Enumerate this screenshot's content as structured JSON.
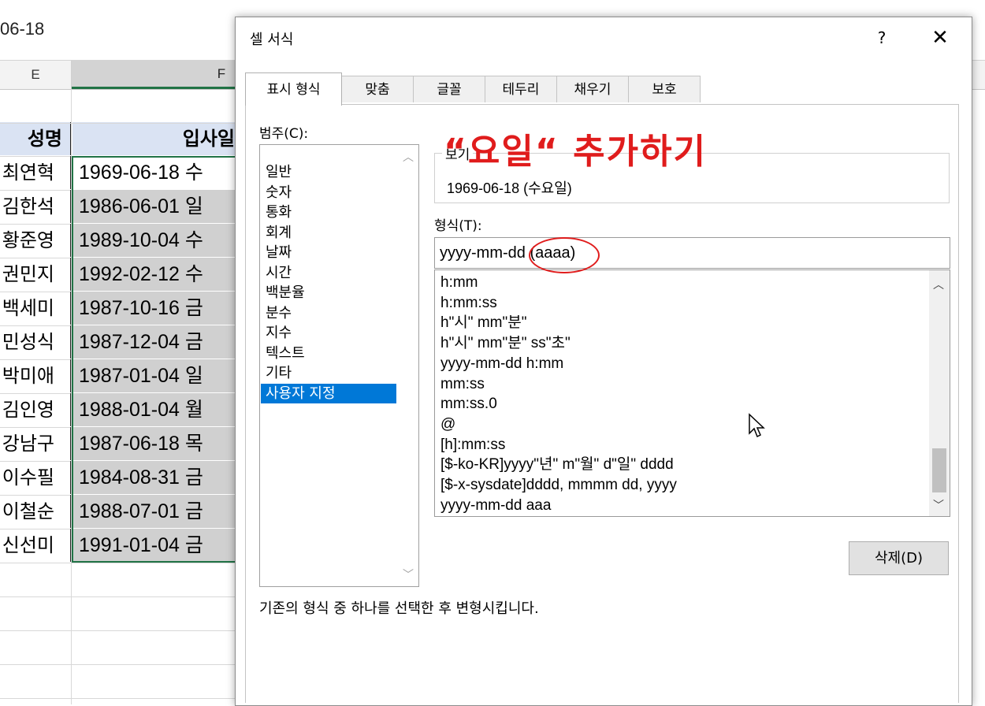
{
  "formula_bar": {
    "text": "06-18"
  },
  "columns": {
    "e": "E",
    "f": "F"
  },
  "sheet": {
    "header": {
      "name": "성명",
      "date": "입사일"
    },
    "rows": [
      {
        "name": "최연혁",
        "date": "1969-06-18 수"
      },
      {
        "name": "김한석",
        "date": "1986-06-01 일"
      },
      {
        "name": "황준영",
        "date": "1989-10-04 수"
      },
      {
        "name": "권민지",
        "date": "1992-02-12 수"
      },
      {
        "name": "백세미",
        "date": "1987-10-16 금"
      },
      {
        "name": "민성식",
        "date": "1987-12-04 금"
      },
      {
        "name": "박미애",
        "date": "1987-01-04 일"
      },
      {
        "name": "김인영",
        "date": "1988-01-04 월"
      },
      {
        "name": "강남구",
        "date": "1987-06-18 목"
      },
      {
        "name": "이수필",
        "date": "1984-08-31 금"
      },
      {
        "name": "이철순",
        "date": "1988-07-01 금"
      },
      {
        "name": "신선미",
        "date": "1991-01-04 금"
      }
    ]
  },
  "dialog": {
    "title": "셀 서식",
    "help": "?",
    "close": "✕",
    "tabs": [
      "표시 형식",
      "맞춤",
      "글꼴",
      "테두리",
      "채우기",
      "보호"
    ],
    "category_label": "범주(C):",
    "categories": [
      "일반",
      "숫자",
      "통화",
      "회계",
      "날짜",
      "시간",
      "백분율",
      "분수",
      "지수",
      "텍스트",
      "기타",
      "사용자 지정"
    ],
    "preview_label": "보기",
    "preview_value": "1969-06-18 (수요일)",
    "format_label": "형식(T):",
    "format_value": "yyyy-mm-dd (aaaa)",
    "format_list": [
      "h:mm",
      "h:mm:ss",
      "h\"시\" mm\"분\"",
      "h\"시\" mm\"분\" ss\"초\"",
      "yyyy-mm-dd h:mm",
      "mm:ss",
      "mm:ss.0",
      "@",
      "[h]:mm:ss",
      "[$-ko-KR]yyyy\"년\" m\"월\" d\"일\" dddd",
      "[$-x-sysdate]dddd, mmmm dd, yyyy",
      "yyyy-mm-dd aaa"
    ],
    "delete_button": "삭제(D)",
    "hint": "기존의 형식 중 하나를 선택한 후 변형시킵니다."
  },
  "annotation": {
    "text": "“요일“ 추가하기",
    "color": "#e01c1c"
  },
  "colors": {
    "selection": "#217346",
    "highlight": "#0078d7",
    "header_fill": "#dae3f3"
  },
  "icons": {
    "help": "help-icon",
    "close": "close-icon",
    "cursor": "mouse-pointer-icon"
  }
}
